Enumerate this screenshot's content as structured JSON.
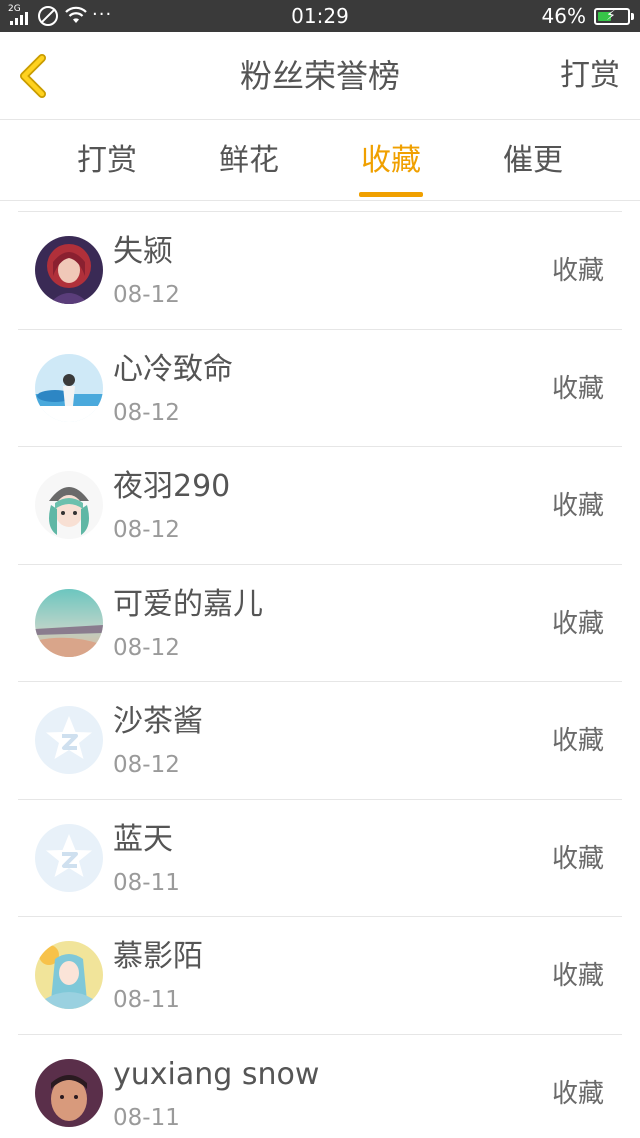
{
  "status_bar": {
    "network": "2G",
    "dots": "···",
    "time": "01:29",
    "battery": "46%",
    "battery_level": 0.46,
    "battery_color": "#37c548"
  },
  "nav": {
    "back_icon": "chevron-left-icon",
    "title": "粉丝荣誉榜",
    "right_action": "打赏"
  },
  "tabs": [
    {
      "label": "打赏",
      "active": false
    },
    {
      "label": "鲜花",
      "active": false
    },
    {
      "label": "收藏",
      "active": true
    },
    {
      "label": "催更",
      "active": false
    }
  ],
  "accent_color": "#f0a000",
  "fans": [
    {
      "name": "失颍",
      "date": "08-12",
      "action": "收藏",
      "avatar": "girl-purple-hair"
    },
    {
      "name": "心冷致命",
      "date": "08-12",
      "action": "收藏",
      "avatar": "sky-figure"
    },
    {
      "name": "夜羽290",
      "date": "08-12",
      "action": "收藏",
      "avatar": "anime-boy-hat"
    },
    {
      "name": "可爱的嘉儿",
      "date": "08-12",
      "action": "收藏",
      "avatar": "sunset-landscape"
    },
    {
      "name": "沙茶酱",
      "date": "08-12",
      "action": "收藏",
      "avatar": "default-qzone-star"
    },
    {
      "name": "蓝天",
      "date": "08-11",
      "action": "收藏",
      "avatar": "default-qzone-star"
    },
    {
      "name": "慕影陌",
      "date": "08-11",
      "action": "收藏",
      "avatar": "anime-girl-teal"
    },
    {
      "name": "yuxiang snow",
      "date": "08-11",
      "action": "收藏",
      "avatar": "person-photo"
    }
  ]
}
